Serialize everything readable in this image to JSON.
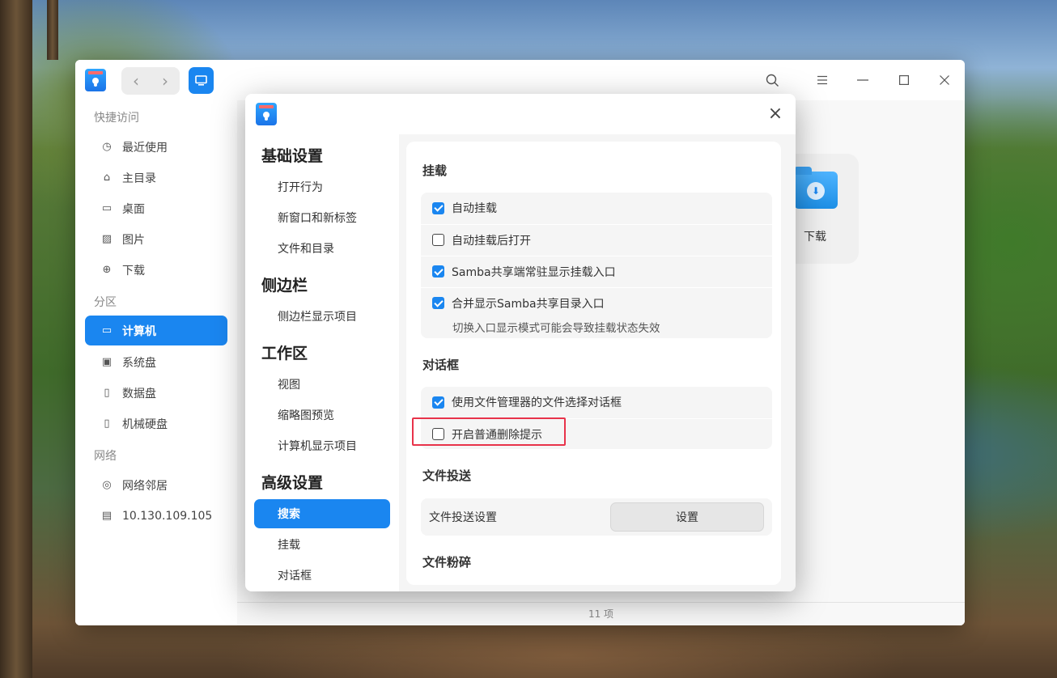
{
  "window": {
    "title_icons": {
      "search": "search-icon",
      "menu": "menu-icon",
      "minimize": "minimize-icon",
      "maximize": "maximize-icon",
      "close": "close-icon"
    },
    "accent": "#1a86f0"
  },
  "sidebar": {
    "quick_access": "快捷访问",
    "quick_items": [
      {
        "label": "最近使用",
        "icon": "clock-icon"
      },
      {
        "label": "主目录",
        "icon": "home-icon"
      },
      {
        "label": "桌面",
        "icon": "desktop-icon"
      },
      {
        "label": "图片",
        "icon": "image-icon"
      },
      {
        "label": "下载",
        "icon": "download-icon"
      }
    ],
    "partition": "分区",
    "partition_items": [
      {
        "label": "计算机",
        "icon": "computer-icon",
        "active": true
      },
      {
        "label": "系统盘",
        "icon": "disk-icon"
      },
      {
        "label": "数据盘",
        "icon": "disk-icon"
      },
      {
        "label": "机械硬盘",
        "icon": "disk-icon"
      }
    ],
    "network": "网络",
    "network_items": [
      {
        "label": "网络邻居",
        "icon": "network-icon"
      },
      {
        "label": "10.130.109.105",
        "icon": "server-icon"
      }
    ]
  },
  "main": {
    "download_folder": "下载",
    "status": "11 项"
  },
  "settings": {
    "nav": {
      "basic": "基础设置",
      "basic_items": [
        "打开行为",
        "新窗口和新标签",
        "文件和目录"
      ],
      "sidebar": "侧边栏",
      "sidebar_items": [
        "侧边栏显示项目"
      ],
      "workspace": "工作区",
      "workspace_items": [
        "视图",
        "缩略图预览",
        "计算机显示项目"
      ],
      "advanced": "高级设置",
      "advanced_items": [
        "搜索",
        "挂载",
        "对话框"
      ]
    },
    "mount": {
      "title": "挂载",
      "options": [
        {
          "label": "自动挂载",
          "checked": true
        },
        {
          "label": "自动挂载后打开",
          "checked": false
        },
        {
          "label": "Samba共享端常驻显示挂载入口",
          "checked": true
        },
        {
          "label": "合并显示Samba共享目录入口",
          "checked": true
        }
      ],
      "note": "切换入口显示模式可能会导致挂载状态失效"
    },
    "dialog": {
      "title": "对话框",
      "options": [
        {
          "label": "使用文件管理器的文件选择对话框",
          "checked": true
        },
        {
          "label": "开启普通删除提示",
          "checked": false
        }
      ]
    },
    "transfer": {
      "title": "文件投送",
      "label": "文件投送设置",
      "button": "设置"
    },
    "shred": {
      "title": "文件粉碎"
    }
  }
}
